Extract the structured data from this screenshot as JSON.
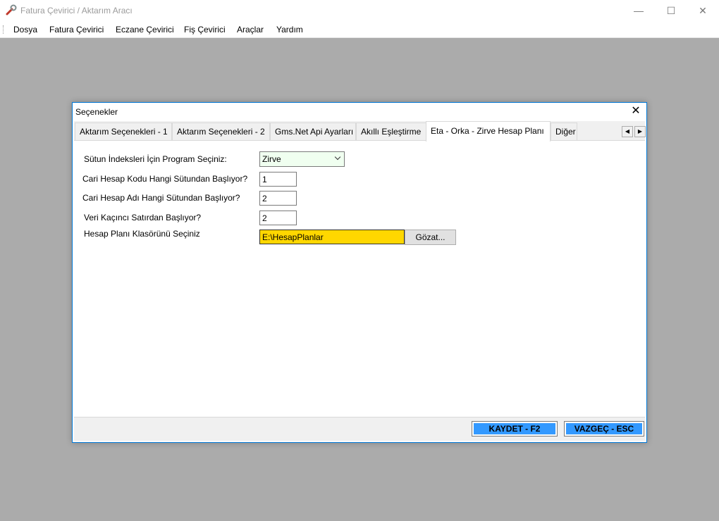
{
  "app": {
    "title": "Fatura Çevirici / Aktarım Aracı",
    "icon": "wrench-icon",
    "window_buttons": {
      "minimize": "—",
      "maximize": "☐",
      "close": "✕"
    }
  },
  "menu": {
    "items": [
      "Dosya",
      "Fatura Çevirici",
      "Eczane Çevirici",
      "Fiş Çevirici",
      "Araçlar",
      "Yardım"
    ]
  },
  "dialog": {
    "title": "Seçenekler",
    "close": "✕",
    "tabs": [
      "Aktarım Seçenekleri - 1",
      "Aktarım Seçenekleri - 2",
      "Gms.Net Api Ayarları",
      "Akıllı Eşleştirme",
      "Eta - Orka - Zirve Hesap Planı",
      "Diğer"
    ],
    "active_tab_index": 4,
    "tab_scroll": {
      "left": "◀",
      "right": "▶"
    },
    "form": {
      "program_label": "Sütun İndeksleri İçin Program Seçiniz:",
      "program_value": "Zirve",
      "cari_kodu_label": "Cari Hesap Kodu Hangi Sütundan Başlıyor?",
      "cari_kodu_value": "1",
      "cari_adi_label": "Cari Hesap Adı Hangi Sütundan Başlıyor?",
      "cari_adi_value": "2",
      "veri_satir_label": "Veri Kaçıncı Satırdan Başlıyor?",
      "veri_satir_value": "2",
      "klasor_label": "Hesap Planı Klasörünü Seçiniz",
      "klasor_value": "E:\\HesapPlanlar",
      "browse_label": "Gözat..."
    },
    "footer": {
      "save_label": "KAYDET - F2",
      "cancel_label": "VAZGEÇ - ESC"
    }
  },
  "colors": {
    "desktop": "#ababab",
    "dialog_border": "#0078d7",
    "accent_button": "#3399ff",
    "highlight_field": "#ffd700",
    "combo_bg": "#f0fff0"
  }
}
